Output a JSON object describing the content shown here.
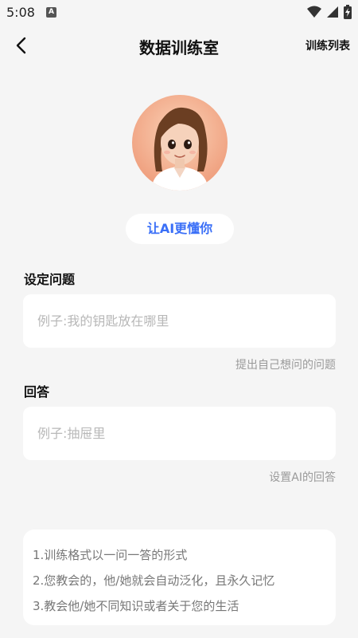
{
  "status_bar": {
    "time": "5:08",
    "notification_badge": "A",
    "icons": [
      "wifi-icon",
      "signal-icon",
      "battery-charging-icon"
    ]
  },
  "nav": {
    "title": "数据训练室",
    "action_label": "训练列表",
    "back_icon": "back-arrow-icon"
  },
  "avatar_icon": "ai-girl-avatar",
  "train_button_label": "让AI更懂你",
  "question": {
    "label": "设定问题",
    "placeholder": "例子:我的钥匙放在哪里",
    "value": "",
    "hint": "提出自己想问的问题"
  },
  "answer": {
    "label": "回答",
    "placeholder": "例子:抽屉里",
    "value": "",
    "hint": "设置AI的回答"
  },
  "info": {
    "lines": [
      "1.训练格式以一问一答的形式",
      "2.您教会的，他/她就会自动泛化，且永久记忆",
      "3.教会他/她不同知识或者关于您的生活"
    ]
  },
  "colors": {
    "background": "#f5f5f5",
    "accent": "#3a6ff7",
    "card": "#ffffff"
  }
}
